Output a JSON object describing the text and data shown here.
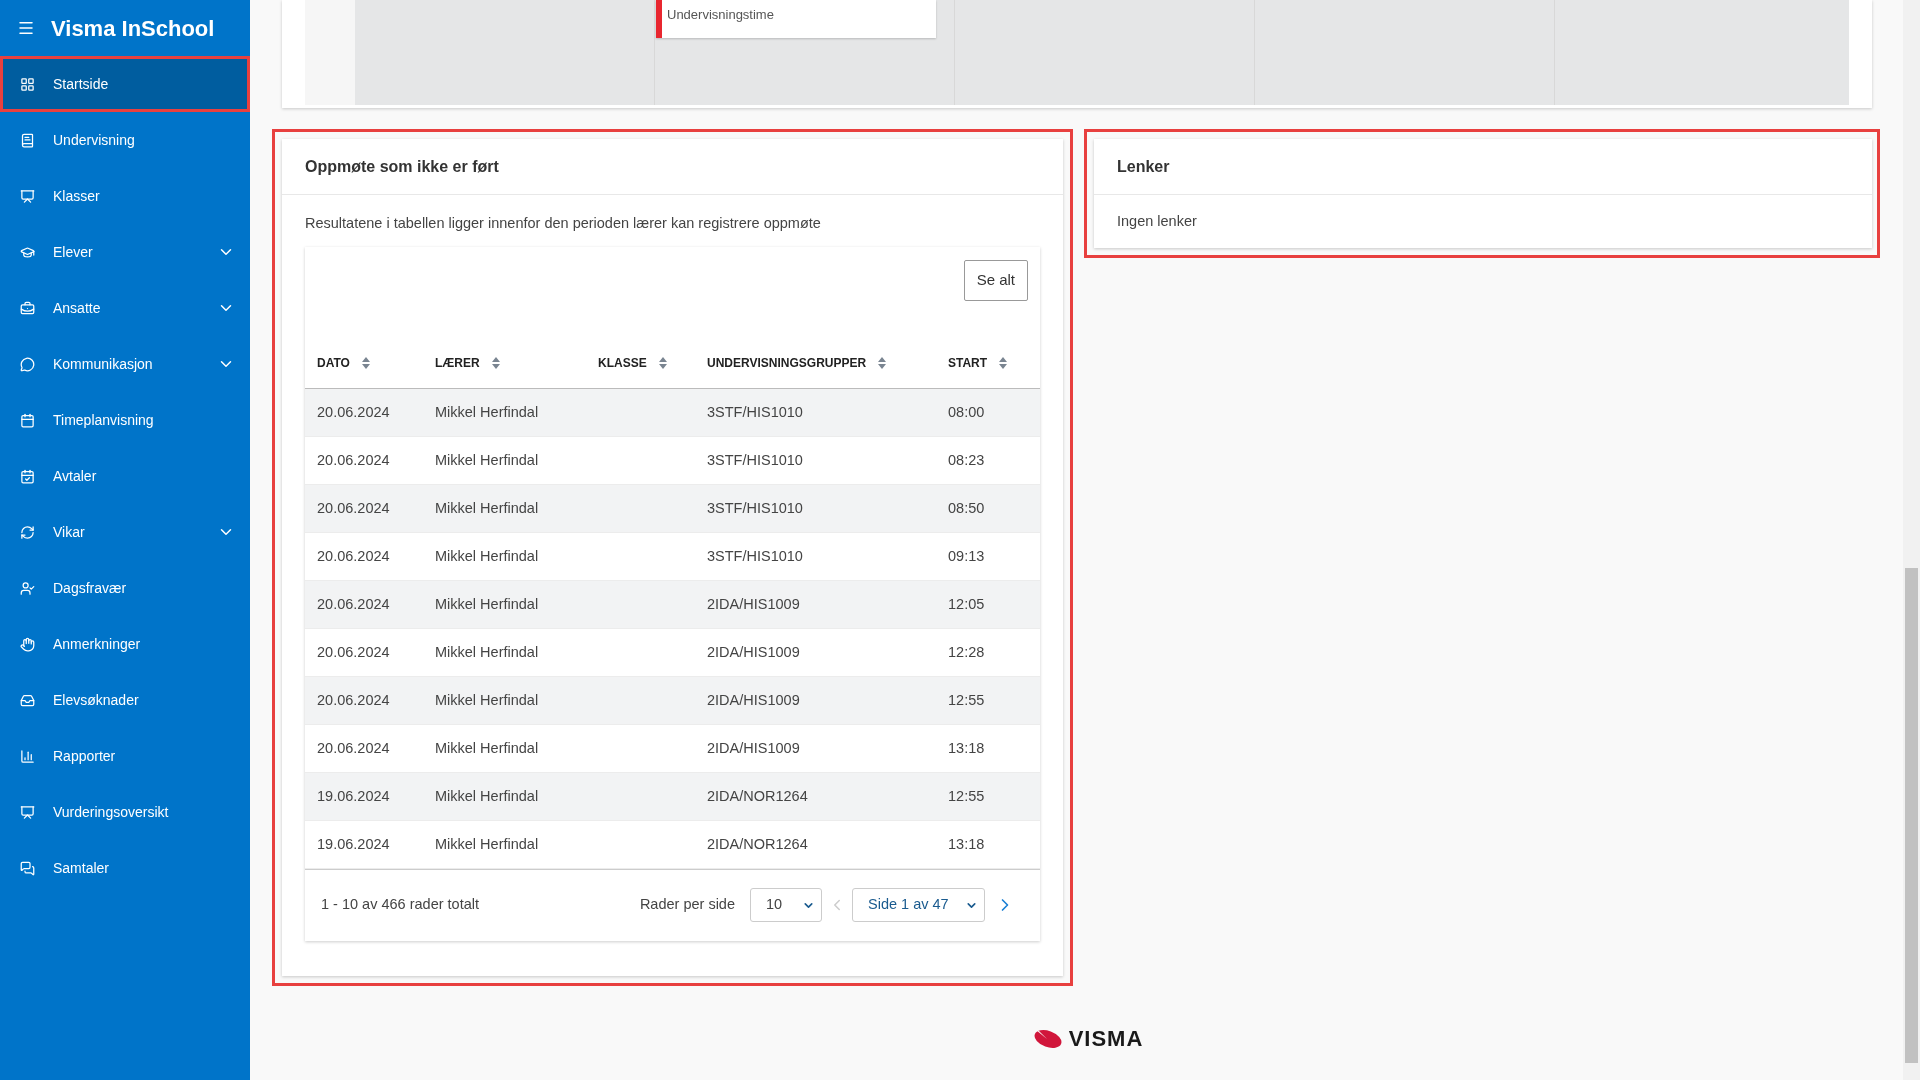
{
  "app": {
    "title": "Visma InSchool"
  },
  "sidebar": {
    "items": [
      {
        "label": "Startside",
        "selected": true
      },
      {
        "label": "Undervisning",
        "selected": false
      },
      {
        "label": "Klasser",
        "selected": false
      },
      {
        "label": "Elever",
        "selected": false,
        "expanded": false
      },
      {
        "label": "Ansatte",
        "selected": false,
        "expanded": false
      },
      {
        "label": "Kommunikasjon",
        "selected": false,
        "expanded": false
      },
      {
        "label": "Timeplanvisning",
        "selected": false
      },
      {
        "label": "Avtaler",
        "selected": false
      },
      {
        "label": "Vikar",
        "selected": false,
        "expanded": false
      },
      {
        "label": "Dagsfravær",
        "selected": false
      },
      {
        "label": "Anmerkninger",
        "selected": false
      },
      {
        "label": "Elevsøknader",
        "selected": false
      },
      {
        "label": "Rapporter",
        "selected": false
      },
      {
        "label": "Vurderingsoversikt",
        "selected": false
      },
      {
        "label": "Samtaler",
        "selected": false
      }
    ]
  },
  "schedule": {
    "event": {
      "type": "Undervisningstime",
      "color": "#e8262f"
    }
  },
  "attendance": {
    "title": "Oppmøte som ikke er ført",
    "description": "Resultatene i tabellen ligger innenfor den perioden lærer kan registrere oppmøte",
    "see_all": "Se alt",
    "table": {
      "columns": [
        "DATO",
        "LÆRER",
        "KLASSE",
        "UNDERVISNINGSGRUPPER",
        "START"
      ],
      "rows": [
        [
          "20.06.2024",
          "Mikkel Herfindal",
          "",
          "3STF/HIS1010",
          "08:00"
        ],
        [
          "20.06.2024",
          "Mikkel Herfindal",
          "",
          "3STF/HIS1010",
          "08:23"
        ],
        [
          "20.06.2024",
          "Mikkel Herfindal",
          "",
          "3STF/HIS1010",
          "08:50"
        ],
        [
          "20.06.2024",
          "Mikkel Herfindal",
          "",
          "3STF/HIS1010",
          "09:13"
        ],
        [
          "20.06.2024",
          "Mikkel Herfindal",
          "",
          "2IDA/HIS1009",
          "12:05"
        ],
        [
          "20.06.2024",
          "Mikkel Herfindal",
          "",
          "2IDA/HIS1009",
          "12:28"
        ],
        [
          "20.06.2024",
          "Mikkel Herfindal",
          "",
          "2IDA/HIS1009",
          "12:55"
        ],
        [
          "20.06.2024",
          "Mikkel Herfindal",
          "",
          "2IDA/HIS1009",
          "13:18"
        ],
        [
          "19.06.2024",
          "Mikkel Herfindal",
          "",
          "2IDA/NOR1264",
          "12:55"
        ],
        [
          "19.06.2024",
          "Mikkel Herfindal",
          "",
          "2IDA/NOR1264",
          "13:18"
        ]
      ]
    },
    "pagination": {
      "summary": "1 - 10 av 466 rader totalt",
      "rows_per_page_label": "Rader per side",
      "rows_per_page": "10",
      "page": "Side 1 av 47",
      "prev_disabled": true,
      "next_disabled": false
    }
  },
  "links": {
    "title": "Lenker",
    "empty_text": "Ingen lenker"
  },
  "footer": {
    "logo_text": "VISMA"
  }
}
